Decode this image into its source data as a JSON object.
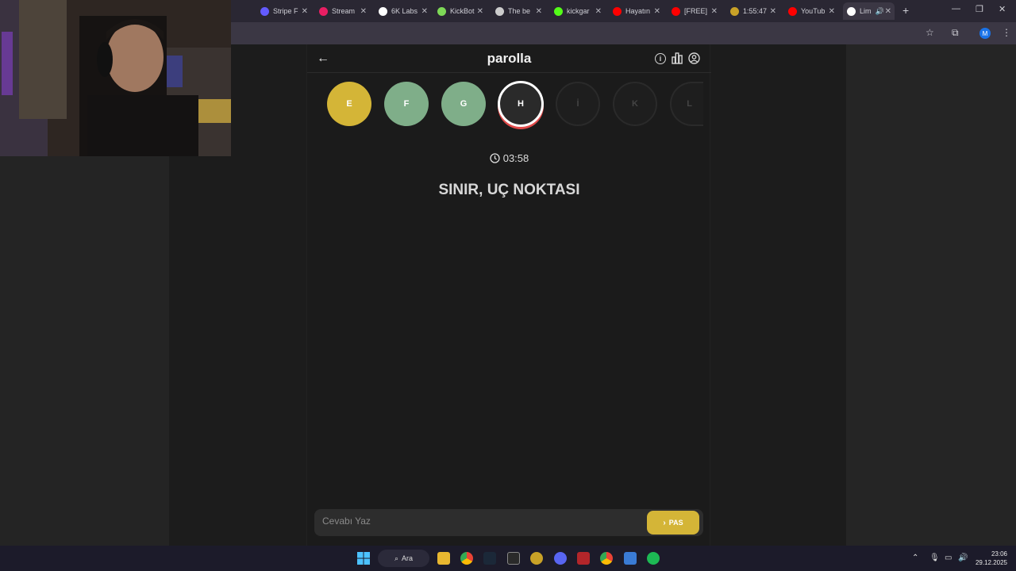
{
  "browser": {
    "tabs": [
      {
        "title": "Stripe F",
        "color": "#635bff"
      },
      {
        "title": "Stream",
        "color": "#e91e63"
      },
      {
        "title": "6K Labs",
        "color": "#ffffff"
      },
      {
        "title": "KickBot",
        "color": "#7ed957"
      },
      {
        "title": "The be",
        "color": "#cccccc"
      },
      {
        "title": "kickgar",
        "color": "#53fc18"
      },
      {
        "title": "Hayatın",
        "color": "#ff0000"
      },
      {
        "title": "[FREE]",
        "color": "#ff0000"
      },
      {
        "title": "1:55:47",
        "color": "#c9a227"
      },
      {
        "title": "YouTub",
        "color": "#ff0000"
      },
      {
        "title": "Lim",
        "color": "#ffffff"
      }
    ],
    "profile_initial": "M"
  },
  "app": {
    "logo": "parolla",
    "letters": [
      {
        "letter": "E",
        "state": "passed"
      },
      {
        "letter": "F",
        "state": "correct"
      },
      {
        "letter": "G",
        "state": "correct"
      },
      {
        "letter": "H",
        "state": "current"
      },
      {
        "letter": "İ",
        "state": "pending"
      },
      {
        "letter": "K",
        "state": "pending"
      },
      {
        "letter": "L",
        "state": "pending"
      }
    ],
    "timer": "03:58",
    "clue": "SINIR, UÇ NOKTASI",
    "answer_placeholder": "Cevabı Yaz",
    "pass_label": "PAS"
  },
  "taskbar": {
    "search_label": "Ara",
    "time": "23:06",
    "date": "29.12.2025"
  },
  "colors": {
    "passed": "#d4b537",
    "correct": "#7fae89",
    "current_ring": "#e04a4a"
  }
}
